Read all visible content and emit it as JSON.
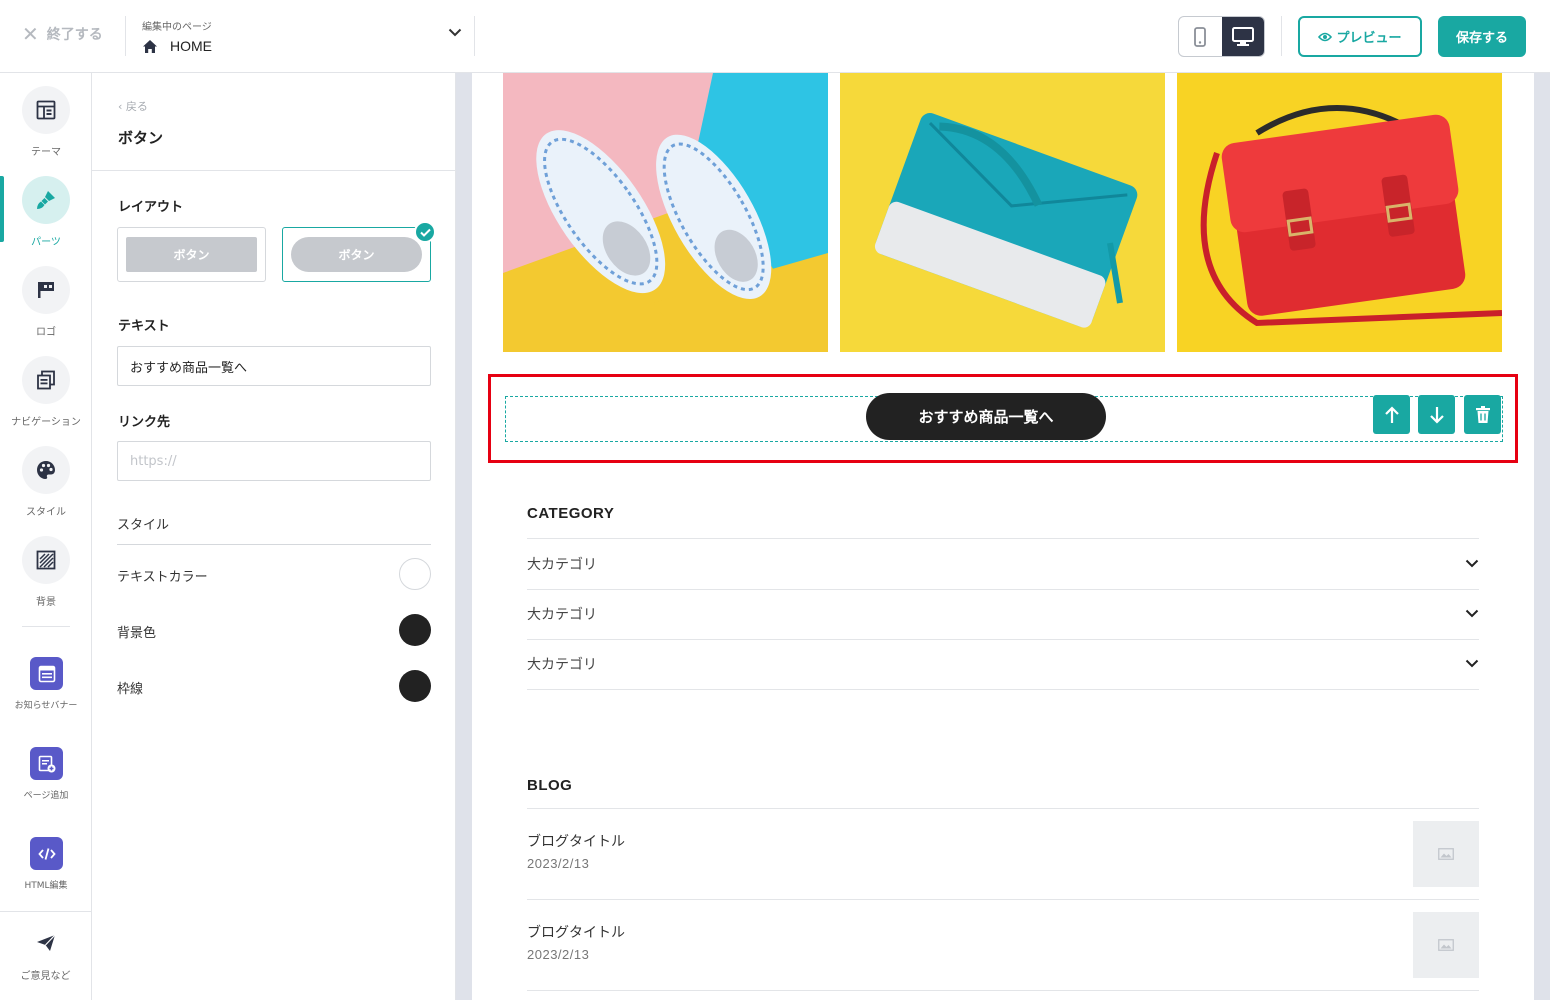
{
  "header": {
    "exit_label": "終了する",
    "editing_caption": "編集中のページ",
    "page_name": "HOME",
    "preview_label": "プレビュー",
    "save_label": "保存する",
    "device_mode": "desktop"
  },
  "rail": {
    "items": [
      {
        "label": "テーマ",
        "icon": "layout-icon"
      },
      {
        "label": "パーツ",
        "icon": "brush-icon",
        "active": true
      },
      {
        "label": "ロゴ",
        "icon": "flag-icon"
      },
      {
        "label": "ナビゲーション",
        "icon": "navigation-icon"
      },
      {
        "label": "スタイル",
        "icon": "palette-icon"
      },
      {
        "label": "背景",
        "icon": "pattern-icon"
      }
    ],
    "tools": [
      {
        "label": "お知らせバナー",
        "icon": "banner-icon"
      },
      {
        "label": "ページ追加",
        "icon": "add-page-icon"
      },
      {
        "label": "HTML編集",
        "icon": "code-icon"
      }
    ],
    "feedback_label": "ご意見など"
  },
  "panel": {
    "back_label": "戻る",
    "title": "ボタン",
    "layout_label": "レイアウト",
    "layout_options": [
      "ボタン",
      "ボタン"
    ],
    "selected_layout": 1,
    "text_label": "テキスト",
    "text_value": "おすすめ商品一覧へ",
    "link_label": "リンク先",
    "link_placeholder": "https://",
    "style_label": "スタイル",
    "colors": [
      {
        "label": "テキストカラー",
        "value": "#ffffff"
      },
      {
        "label": "背景色",
        "value": "#222222"
      },
      {
        "label": "枠線",
        "value": "#222222"
      }
    ]
  },
  "canvas": {
    "cta_label": "おすすめ商品一覧へ",
    "category_heading": "CATEGORY",
    "categories": [
      "大カテゴリ",
      "大カテゴリ",
      "大カテゴリ"
    ],
    "blog_heading": "BLOG",
    "blog_posts": [
      {
        "title": "ブログタイトル",
        "date": "2023/2/13"
      },
      {
        "title": "ブログタイトル",
        "date": "2023/2/13"
      }
    ]
  },
  "colors": {
    "accent": "#19a8a2",
    "selection": "#e60012",
    "rail_tool": "#5959c8"
  }
}
